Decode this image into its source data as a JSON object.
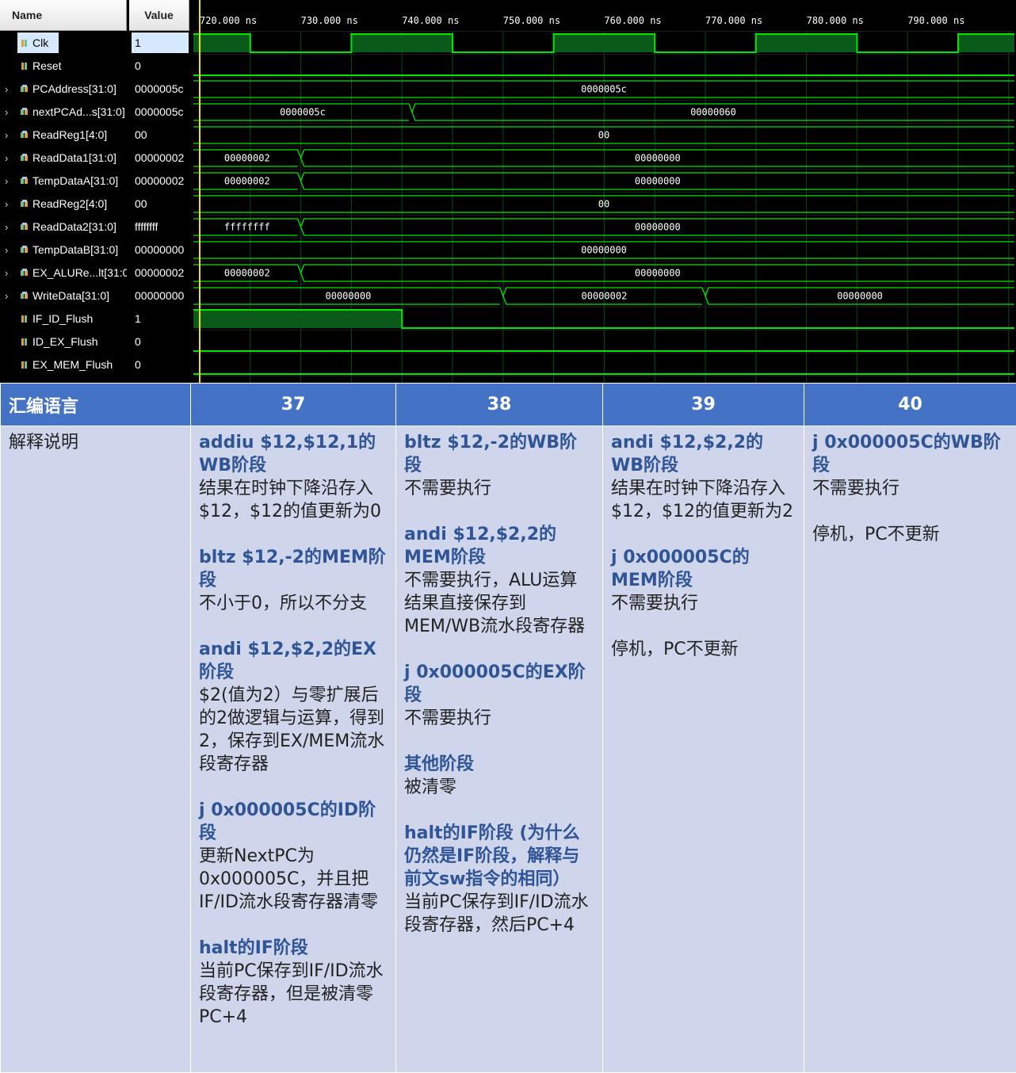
{
  "waveform": {
    "headers": {
      "name": "Name",
      "value": "Value"
    },
    "timeline": [
      "720.000 ns",
      "730.000 ns",
      "740.000 ns",
      "750.000 ns",
      "760.000 ns",
      "770.000 ns",
      "780.000 ns",
      "790.000 ns"
    ],
    "signals": [
      {
        "name": "Clk",
        "value": "1",
        "type": "bit",
        "expandable": false
      },
      {
        "name": "Reset",
        "value": "0",
        "type": "bit",
        "expandable": false
      },
      {
        "name": "PCAddress[31:0]",
        "value": "0000005c",
        "type": "bus",
        "expandable": true,
        "segments": [
          "0000005c"
        ]
      },
      {
        "name": "nextPCAd...s[31:0]",
        "value": "0000005c",
        "type": "bus",
        "expandable": true,
        "segments": [
          "0000005c",
          "00000060"
        ]
      },
      {
        "name": "ReadReg1[4:0]",
        "value": "00",
        "type": "bus",
        "expandable": true,
        "segments": [
          "00"
        ]
      },
      {
        "name": "ReadData1[31:0]",
        "value": "00000002",
        "type": "bus",
        "expandable": true,
        "segments": [
          "00000002",
          "00000000"
        ]
      },
      {
        "name": "TempDataA[31:0]",
        "value": "00000002",
        "type": "bus",
        "expandable": true,
        "segments": [
          "00000002",
          "00000000"
        ]
      },
      {
        "name": "ReadReg2[4:0]",
        "value": "00",
        "type": "bus",
        "expandable": true,
        "segments": [
          "00"
        ]
      },
      {
        "name": "ReadData2[31:0]",
        "value": "ffffffff",
        "type": "bus",
        "expandable": true,
        "segments": [
          "ffffffff",
          "00000000"
        ]
      },
      {
        "name": "TempDataB[31:0]",
        "value": "00000000",
        "type": "bus",
        "expandable": true,
        "segments": [
          "00000000"
        ]
      },
      {
        "name": "EX_ALURe...lt[31:0]",
        "value": "00000002",
        "type": "bus",
        "expandable": true,
        "segments": [
          "00000002",
          "00000000"
        ]
      },
      {
        "name": "WriteData[31:0]",
        "value": "00000000",
        "type": "bus",
        "expandable": true,
        "segments": [
          "00000000",
          "00000002",
          "00000000"
        ]
      },
      {
        "name": "IF_ID_Flush",
        "value": "1",
        "type": "bit",
        "expandable": false
      },
      {
        "name": "ID_EX_Flush",
        "value": "0",
        "type": "bit",
        "expandable": false
      },
      {
        "name": "EX_MEM_Flush",
        "value": "0",
        "type": "bit",
        "expandable": false
      }
    ]
  },
  "table": {
    "header": {
      "label": "汇编语言",
      "cycles": [
        "37",
        "38",
        "39",
        "40"
      ]
    },
    "row_label": "解释说明",
    "cells": [
      [
        {
          "title": "addiu  $12,$12,1的WB阶段",
          "text": "结果在时钟下降沿存入$12，$12的值更新为0"
        },
        {
          "title": "bltz  $12,-2的MEM阶段",
          "text": "不小于0，所以不分支"
        },
        {
          "title": "andi  $12,$2,2的EX阶段",
          "text": "$2(值为2）与零扩展后的2做逻辑与运算，得到2，保存到EX/MEM流水段寄存器"
        },
        {
          "title": "j  0x000005C的ID阶段",
          "text": "更新NextPC为0x000005C，并且把IF/ID流水段寄存器清零"
        },
        {
          "title": "halt的IF阶段",
          "text": "当前PC保存到IF/ID流水段寄存器，但是被清零PC+4"
        }
      ],
      [
        {
          "title": "bltz  $12,-2的WB阶段",
          "text": "不需要执行"
        },
        {
          "title": "andi  $12,$2,2的MEM阶段",
          "text": "不需要执行，ALU运算结果直接保存到MEM/WB流水段寄存器"
        },
        {
          "title": "j  0x000005C的EX阶段",
          "text": "不需要执行"
        },
        {
          "title": "其他阶段",
          "text": "被清零"
        },
        {
          "title": "halt的IF阶段 (为什么仍然是IF阶段，解释与前文sw指令的相同）",
          "text": "当前PC保存到IF/ID流水段寄存器，然后PC+4"
        }
      ],
      [
        {
          "title": "andi  $12,$2,2的WB阶段",
          "text": "结果在时钟下降沿存入$12，$12的值更新为2"
        },
        {
          "title": "j  0x000005C的MEM阶段",
          "text": "不需要执行"
        },
        {
          "title": "",
          "text": "停机，PC不更新"
        }
      ],
      [
        {
          "title": "j  0x000005C的WB阶段",
          "text": "不需要执行"
        },
        {
          "title": "",
          "text": "停机，PC不更新"
        }
      ]
    ]
  },
  "colors": {
    "wave_green": "#00e600",
    "clk_fill": "#0a5a1a",
    "grid": "#0a4a1a",
    "cursor": "#e6e600",
    "header_blue": "#4472c4",
    "cell_bg": "#cfd5ea",
    "title_blue": "#2f5597"
  }
}
